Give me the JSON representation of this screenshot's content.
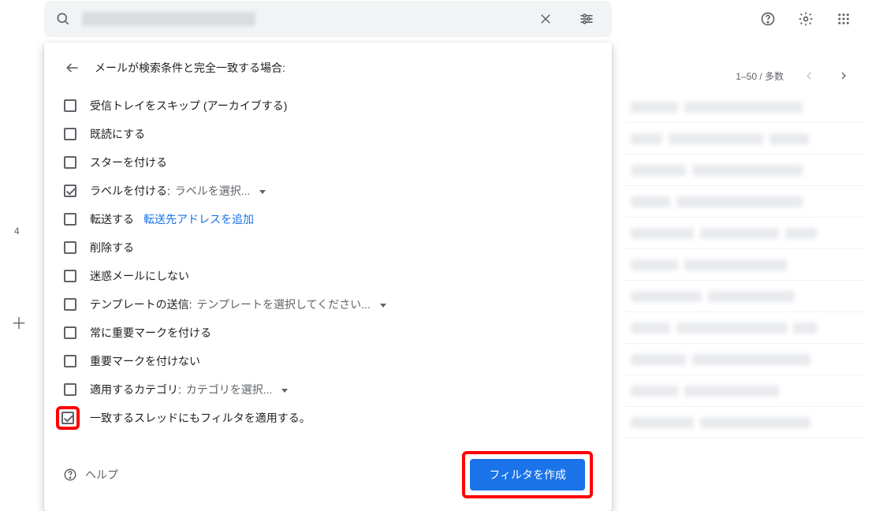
{
  "topbar": {
    "search_icon": "search-icon",
    "clear_icon": "clear-icon",
    "tune_icon": "tune-icon",
    "help_icon": "help-icon",
    "settings_icon": "settings-icon",
    "apps_icon": "apps-icon"
  },
  "sidebar": {
    "badge_count": "4"
  },
  "filter": {
    "title": "メールが検索条件と完全一致する場合:",
    "options": [
      {
        "label": "受信トレイをスキップ (アーカイブする)",
        "checked": false
      },
      {
        "label": "既読にする",
        "checked": false
      },
      {
        "label": "スターを付ける",
        "checked": false
      },
      {
        "label": "ラベルを付ける:",
        "sub": "ラベルを選択...",
        "checked": true,
        "has_dropdown": true
      },
      {
        "label": "転送する",
        "link": "転送先アドレスを追加",
        "checked": false
      },
      {
        "label": "削除する",
        "checked": false
      },
      {
        "label": "迷惑メールにしない",
        "checked": false
      },
      {
        "label": "テンプレートの送信:",
        "sub": "テンプレートを選択してください...",
        "checked": false,
        "has_dropdown": true
      },
      {
        "label": "常に重要マークを付ける",
        "checked": false
      },
      {
        "label": "重要マークを付けない",
        "checked": false
      },
      {
        "label": "適用するカテゴリ:",
        "sub": "カテゴリを選択...",
        "checked": false,
        "has_dropdown": true
      },
      {
        "label": "一致するスレッドにもフィルタを適用する。",
        "checked": true,
        "highlighted": true
      }
    ],
    "help_label": "ヘルプ",
    "create_button": "フィルタを作成"
  },
  "mail": {
    "pagination": "1–50 / 多数"
  }
}
